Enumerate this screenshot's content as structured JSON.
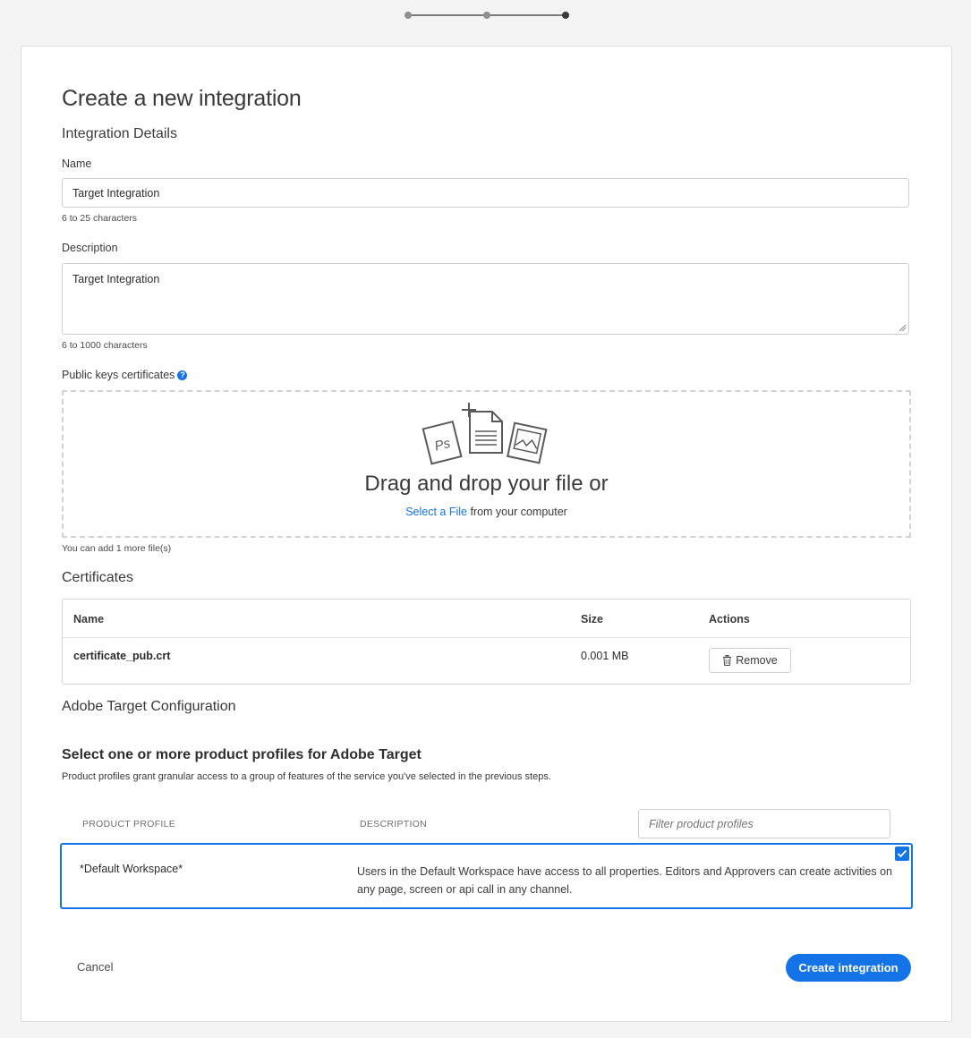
{
  "stepper": {
    "steps": 3,
    "current_step": 3
  },
  "page": {
    "title": "Create a new integration",
    "section_details": "Integration Details"
  },
  "name_field": {
    "label": "Name",
    "value": "Target Integration",
    "hint": "6 to 25 characters"
  },
  "description_field": {
    "label": "Description",
    "value": "Target Integration",
    "hint": "6 to 1000 characters"
  },
  "public_keys": {
    "label": "Public keys certificates",
    "help_icon": "question-circle-icon",
    "dropzone_title": "Drag and drop your file or",
    "select_link": "Select a File",
    "select_suffix": " from your computer",
    "file_hint": "You can add 1 more file(s)"
  },
  "certificates": {
    "title": "Certificates",
    "columns": {
      "name": "Name",
      "size": "Size",
      "actions": "Actions"
    },
    "rows": [
      {
        "name": "certificate_pub.crt",
        "size": "0.001 MB",
        "action_label": "Remove",
        "action_icon": "trash-icon"
      }
    ]
  },
  "target_config": {
    "title": "Adobe Target Configuration",
    "profiles_title": "Select one or more product profiles for Adobe Target",
    "profiles_desc": "Product profiles grant granular access to a group of features of the service you've selected in the previous steps.",
    "col_profile": "PRODUCT PROFILE",
    "col_description": "DESCRIPTION",
    "filter_placeholder": "Filter product profiles",
    "profiles": [
      {
        "name": "*Default Workspace*",
        "description": "Users in the Default Workspace have access to all properties. Editors and Approvers can create activities on any page, screen or api call in any channel.",
        "selected": true
      }
    ]
  },
  "footer": {
    "cancel_label": "Cancel",
    "create_label": "Create integration"
  },
  "colors": {
    "accent": "#1473e6",
    "text": "#323232",
    "background": "#f4f4f4"
  }
}
